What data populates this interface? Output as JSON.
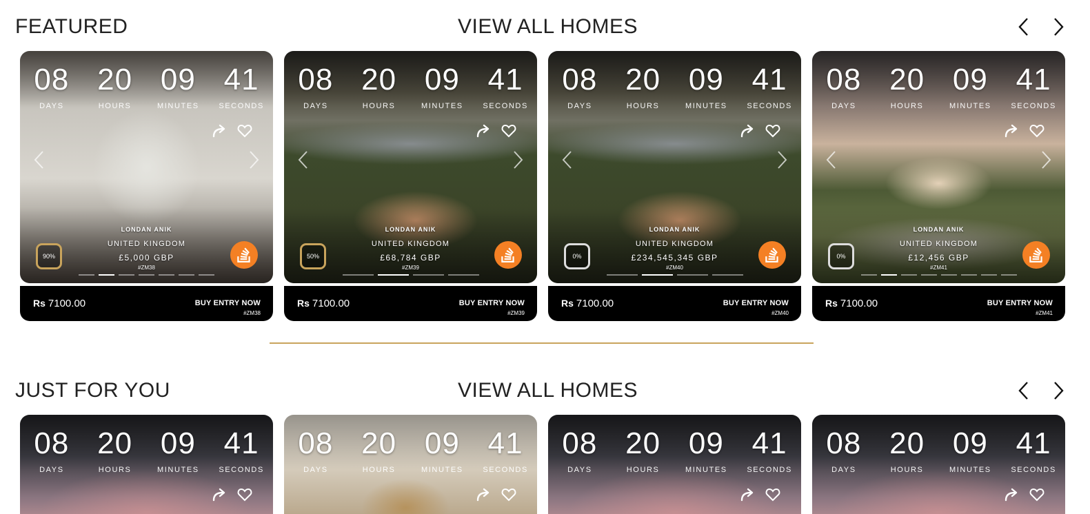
{
  "featured": {
    "title": "FEATURED",
    "view_all": "VIEW ALL HOMES",
    "cards": [
      {
        "timer": {
          "days": "08",
          "hours": "20",
          "minutes": "09",
          "seconds": "41"
        },
        "agent": "LONDAN ANIK",
        "country": "UNITED KINGDOM",
        "price": "£5,000 GBP",
        "code": "#ZM38",
        "percent": "90%",
        "buy_price": "7100.00",
        "dots": 7,
        "active_dot": 1,
        "photo": "hall"
      },
      {
        "timer": {
          "days": "08",
          "hours": "20",
          "minutes": "09",
          "seconds": "41"
        },
        "agent": "LONDAN ANIK",
        "country": "UNITED KINGDOM",
        "price": "£68,784 GBP",
        "code": "#ZM39",
        "percent": "50%",
        "buy_price": "7100.00",
        "dots": 4,
        "active_dot": 1,
        "photo": "estate"
      },
      {
        "timer": {
          "days": "08",
          "hours": "20",
          "minutes": "09",
          "seconds": "41"
        },
        "agent": "LONDAN ANIK",
        "country": "UNITED KINGDOM",
        "price": "£234,545,345 GBP",
        "code": "#ZM40",
        "percent": "0%",
        "buy_price": "7100.00",
        "dots": 4,
        "active_dot": 1,
        "photo": "estate"
      },
      {
        "timer": {
          "days": "08",
          "hours": "20",
          "minutes": "09",
          "seconds": "41"
        },
        "agent": "LONDAN ANIK",
        "country": "UNITED KINGDOM",
        "price": "£12,456 GBP",
        "code": "#ZM41",
        "percent": "0%",
        "buy_price": "7100.00",
        "dots": 8,
        "active_dot": 1,
        "photo": "mansion"
      }
    ]
  },
  "just_for_you": {
    "title": "JUST FOR YOU",
    "view_all": "VIEW ALL HOMES",
    "cards": [
      {
        "timer": {
          "days": "08",
          "hours": "20",
          "minutes": "09",
          "seconds": "41"
        },
        "photo": "dusk"
      },
      {
        "timer": {
          "days": "08",
          "hours": "20",
          "minutes": "09",
          "seconds": "41"
        },
        "photo": "interior"
      },
      {
        "timer": {
          "days": "08",
          "hours": "20",
          "minutes": "09",
          "seconds": "41"
        },
        "photo": "dusk"
      },
      {
        "timer": {
          "days": "08",
          "hours": "20",
          "minutes": "09",
          "seconds": "41"
        },
        "photo": "dusk"
      }
    ]
  },
  "labels": {
    "days": "DAYS",
    "hours": "HOURS",
    "minutes": "MINUTES",
    "seconds": "SECONDS",
    "currency": "Rs",
    "buy_entry": "BUY ENTRY NOW"
  },
  "icons": {
    "prev": "chevron-left-icon",
    "next": "chevron-right-icon",
    "share": "share-arrow-icon",
    "like": "heart-icon",
    "stack": "stackoverflow-icon"
  },
  "colors": {
    "accent_gold": "#c9a45c",
    "badge_orange": "#f48024",
    "buy_bar": "#000000",
    "text_dark": "#222222"
  }
}
